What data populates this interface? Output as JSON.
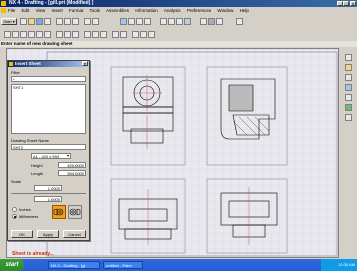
{
  "window": {
    "title": "NX 4 - Drafting - [gill.prt (Modified) ]"
  },
  "menu": [
    "File",
    "Edit",
    "View",
    "Insert",
    "Format",
    "Tools",
    "Assemblies",
    "Information",
    "Analysis",
    "Preferences",
    "Window",
    "Help"
  ],
  "toolbar": {
    "start_label": "Start"
  },
  "cue_line": "Enter name of new drawing sheet",
  "dialog": {
    "title": "Insert Sheet",
    "filter_label": "Filter",
    "filter_value": "*",
    "list_item": "SHT1",
    "sheet_name_label": "Drawing Sheet Name",
    "sheet_name_value": "SHT2",
    "size_value": "A1 - 420 x 594",
    "height_label": "Height",
    "height_value": "420.0000",
    "length_label": "Length",
    "length_value": "594.0000",
    "scale_label": "Scale",
    "scale_value1": "1.0000",
    "scale_value2": "1.0000",
    "units": [
      "Inches",
      "Millimeters"
    ],
    "units_selected": "Millimeters",
    "ok_label": "OK",
    "apply_label": "Apply",
    "cancel_label": "Cancel"
  },
  "status_text": "(Sketch)",
  "status_message": "Sheet is already...",
  "taskbar": {
    "start": "start",
    "tasks": [
      "NX 4 - Drafting - [gi...",
      "untitled - Paint"
    ],
    "clock": "10:35 AM"
  }
}
